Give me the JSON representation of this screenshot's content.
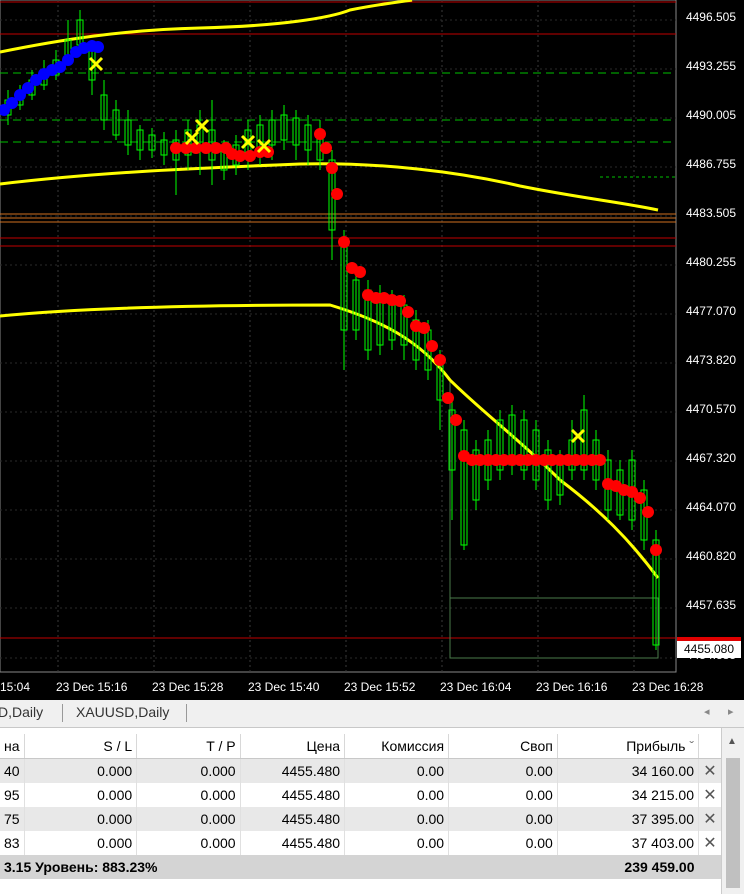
{
  "chart": {
    "price_axis": [
      "4496.505",
      "4493.255",
      "4490.005",
      "4486.755",
      "4483.505",
      "4480.255",
      "4477.070",
      "4473.820",
      "4470.570",
      "4467.320",
      "4464.070",
      "4460.820",
      "4457.635",
      "4454.385"
    ],
    "current_price": "4455.080",
    "time_axis": [
      "15:04",
      "23 Dec 15:16",
      "23 Dec 15:28",
      "23 Dec 15:40",
      "23 Dec 15:52",
      "23 Dec 16:04",
      "23 Dec 16:16",
      "23 Dec 16:28"
    ],
    "colors": {
      "background": "#000000",
      "candle": "#00ff00",
      "upper_band": "#ffff00",
      "lower_band": "#ffff00",
      "sell_dots": "#ff0000",
      "buy_dots": "#0000ff",
      "signal_cross": "#ffff00",
      "levels": "#c00000"
    }
  },
  "tabs": [
    "D,Daily",
    "XAUUSD,Daily"
  ],
  "terminal": {
    "columns": [
      "на",
      "S / L",
      "T / P",
      "Цена",
      "Комиссия",
      "Своп",
      "Прибыль"
    ],
    "rows": [
      {
        "c0": "40",
        "sl": "0.000",
        "tp": "0.000",
        "price": "4455.480",
        "commission": "0.00",
        "swap": "0.00",
        "profit": "34 160.00"
      },
      {
        "c0": "95",
        "sl": "0.000",
        "tp": "0.000",
        "price": "4455.480",
        "commission": "0.00",
        "swap": "0.00",
        "profit": "34 215.00"
      },
      {
        "c0": "75",
        "sl": "0.000",
        "tp": "0.000",
        "price": "4455.480",
        "commission": "0.00",
        "swap": "0.00",
        "profit": "37 395.00"
      },
      {
        "c0": "83",
        "sl": "0.000",
        "tp": "0.000",
        "price": "4455.480",
        "commission": "0.00",
        "swap": "0.00",
        "profit": "37 403.00"
      }
    ],
    "summary": {
      "left": "3.15  Уровень: 883.23%",
      "profit": "239 459.00"
    },
    "close_icon": "✕",
    "sort_icon": "ˇ"
  }
}
